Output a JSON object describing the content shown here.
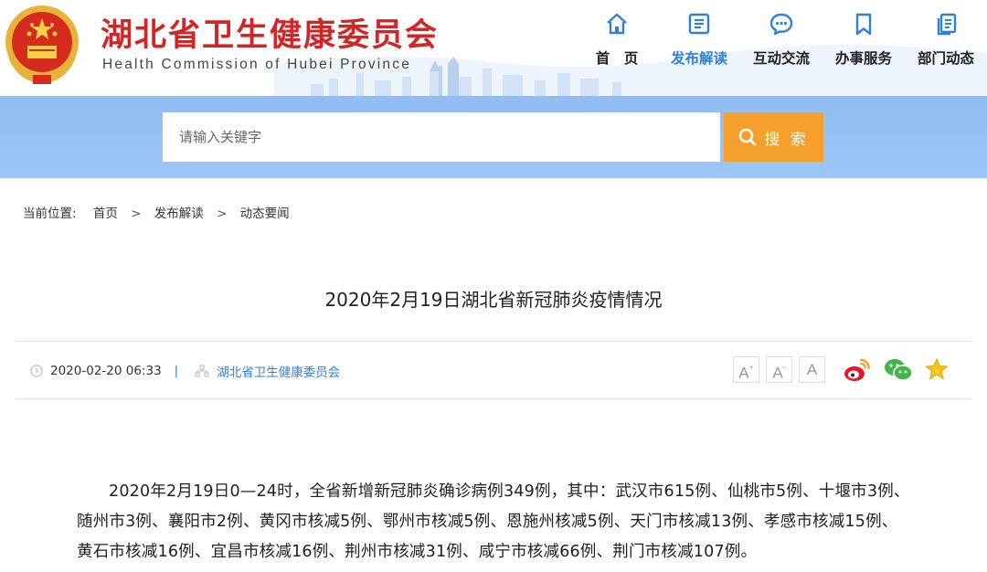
{
  "header": {
    "title": "湖北省卫生健康委员会",
    "subtitle": "Health Commission of Hubei Province"
  },
  "nav": {
    "items": [
      {
        "label": "首　页",
        "icon": "home-icon",
        "active": false
      },
      {
        "label": "发布解读",
        "icon": "document-list-icon",
        "active": true
      },
      {
        "label": "互动交流",
        "icon": "chat-bubble-icon",
        "active": false
      },
      {
        "label": "办事服务",
        "icon": "bookmark-icon",
        "active": false
      },
      {
        "label": "部门动态",
        "icon": "copy-document-icon",
        "active": false
      }
    ]
  },
  "search": {
    "placeholder": "请输入关键字",
    "button_label": "搜 索"
  },
  "breadcrumb": {
    "label": "当前位置:",
    "items": [
      "首页",
      "发布解读",
      "动态要闻"
    ],
    "separator": ">"
  },
  "article": {
    "title": "2020年2月19日湖北省新冠肺炎疫情情况",
    "date": "2020-02-20 06:33",
    "divider": "|",
    "source": "湖北省卫生健康委员会",
    "font_controls": [
      "A+",
      "A-",
      "A"
    ],
    "share": [
      "weibo-icon",
      "wechat-icon",
      "favorite-star-icon"
    ],
    "body": "2020年2月19日0—24时，全省新增新冠肺炎确诊病例349例，其中：武汉市615例、仙桃市5例、十堰市3例、随州市3例、襄阳市2例、黄冈市核减5例、鄂州市核减5例、恩施州核减5例、天门市核减13例、孝感市核减15例、黄石市核减16例、宜昌市核减16例、荆州市核减31例、咸宁市核减66例、荆门市核减107例。"
  },
  "colors": {
    "brand_red": "#d22525",
    "accent_blue": "#2f7fde",
    "search_orange": "#f5a02c",
    "band_blue": "#95c1f5"
  }
}
